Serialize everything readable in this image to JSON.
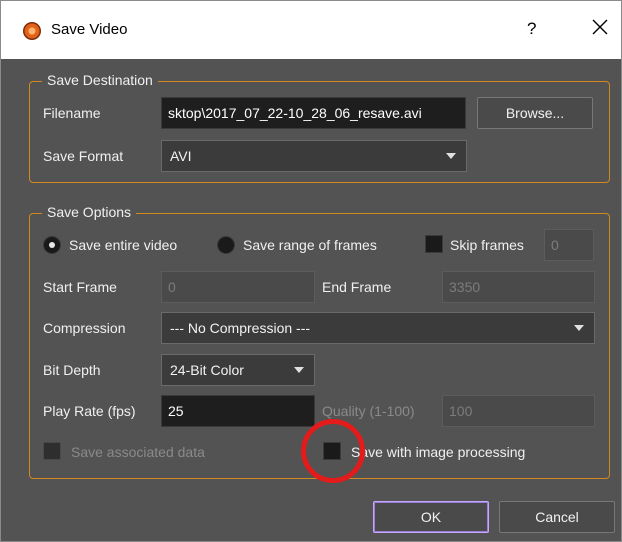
{
  "window": {
    "title": "Save Video",
    "help_label": "?"
  },
  "save_destination": {
    "group_title": "Save Destination",
    "filename_label": "Filename",
    "filename_value": "sktop\\2017_07_22-10_28_06_resave.avi",
    "browse_label": "Browse...",
    "format_label": "Save Format",
    "format_value": "AVI"
  },
  "save_options": {
    "group_title": "Save Options",
    "radio_entire": "Save entire video",
    "radio_range": "Save range of frames",
    "skip_frames_label": "Skip frames",
    "skip_frames_value": "0",
    "start_frame_label": "Start Frame",
    "start_frame_value": "0",
    "end_frame_label": "End Frame",
    "end_frame_value": "3350",
    "compression_label": "Compression",
    "compression_value": "--- No Compression ---",
    "bit_depth_label": "Bit Depth",
    "bit_depth_value": "24-Bit Color",
    "play_rate_label": "Play Rate (fps)",
    "play_rate_value": "25",
    "quality_label": "Quality (1-100)",
    "quality_value": "100",
    "save_associated_label": "Save associated data",
    "save_processing_label": "Save with image processing"
  },
  "footer": {
    "ok_label": "OK",
    "cancel_label": "Cancel"
  },
  "colors": {
    "dialog_bg": "#535353",
    "group_border": "#d1891f",
    "annotation_circle": "#e41b1b",
    "ok_border": "#c8a6ff"
  }
}
